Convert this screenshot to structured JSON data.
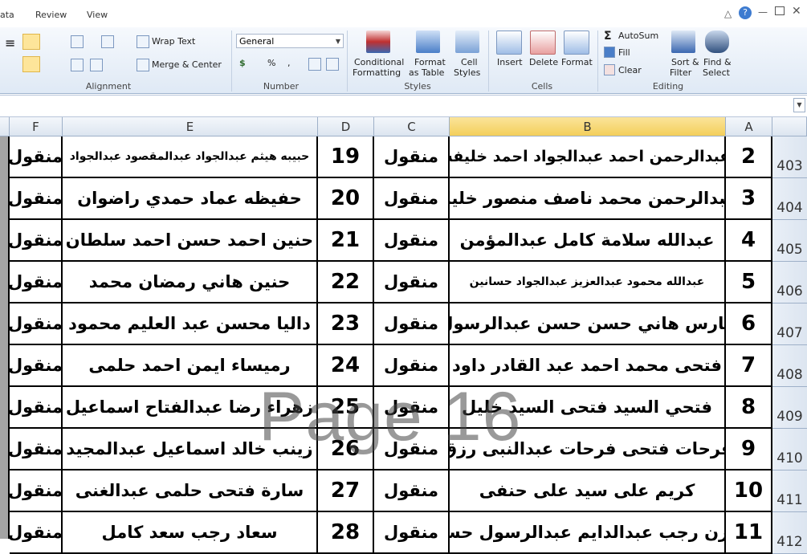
{
  "menu": {
    "items": [
      "ata",
      "Review",
      "View"
    ]
  },
  "ribbon": {
    "alignment": {
      "wrap_text": "Wrap Text",
      "merge_center": "Merge & Center",
      "label": "Alignment"
    },
    "number": {
      "format": "General",
      "currency": "$",
      "percent": "%",
      "comma": ",",
      "label": "Number"
    },
    "styles": {
      "conditional": "Conditional",
      "formatting": "Formatting",
      "format": "Format",
      "as_table": "as Table",
      "cell": "Cell",
      "cell_styles": "Styles",
      "label": "Styles"
    },
    "cells": {
      "insert": "Insert",
      "delete": "Delete",
      "format": "Format",
      "label": "Cells"
    },
    "editing": {
      "autosum": "AutoSum",
      "fill": "Fill",
      "clear": "Clear",
      "sort1": "Sort &",
      "sort2": "Filter",
      "find1": "Find &",
      "find2": "Select",
      "label": "Editing"
    }
  },
  "columns": [
    "F",
    "E",
    "D",
    "C",
    "B",
    "A"
  ],
  "rows": [
    {
      "row": "403",
      "A": "2",
      "B": "عبدالرحمن احمد عبدالجواد احمد خليفة",
      "C": "منقول",
      "D": "19",
      "E": "حبيبه هيثم عبدالجواد عبدالمقصود عبدالجواد",
      "F": "منقول"
    },
    {
      "row": "404",
      "A": "3",
      "B": "عبدالرحمن محمد ناصف منصور خليل",
      "C": "منقول",
      "D": "20",
      "E": "حفيظه عماد حمدي راضوان",
      "F": "منقول"
    },
    {
      "row": "405",
      "A": "4",
      "B": "عبدالله سلامة كامل عبدالمؤمن",
      "C": "منقول",
      "D": "21",
      "E": "حنين احمد حسن احمد سلطان",
      "F": "منقول"
    },
    {
      "row": "406",
      "A": "5",
      "B": "عبدالله محمود عبدالعزيز عبدالجواد حسانين",
      "C": "منقول",
      "D": "22",
      "E": "حنين هاني رمضان محمد",
      "F": "منقول"
    },
    {
      "row": "407",
      "A": "6",
      "B": "فارس هاني حسن حسن عبدالرسول",
      "C": "منقول",
      "D": "23",
      "E": "داليا محسن عبد العليم محمود",
      "F": "منقول"
    },
    {
      "row": "408",
      "A": "7",
      "B": "فتحى محمد احمد عبد القادر داود",
      "C": "منقول",
      "D": "24",
      "E": "رميساء ايمن احمد حلمى",
      "F": "منقول"
    },
    {
      "row": "409",
      "A": "8",
      "B": "فتحي السيد فتحى السيد خليل",
      "C": "منقول",
      "D": "25",
      "E": "زهراء رضا عبدالفتاح اسماعيل",
      "F": "منقول"
    },
    {
      "row": "410",
      "A": "9",
      "B": "فرحات فتحى فرحات عبدالنبى رزق",
      "C": "منقول",
      "D": "26",
      "E": "زينب خالد اسماعيل عبدالمجيد",
      "F": "منقول"
    },
    {
      "row": "411",
      "A": "10",
      "B": "كريم على سيد على حنفى",
      "C": "منقول",
      "D": "27",
      "E": "سارة فتحى حلمى عبدالغنى",
      "F": "منقول"
    },
    {
      "row": "412",
      "A": "11",
      "B": "مازن رجب عبدالدايم عبدالرسول حسن",
      "C": "منقول",
      "D": "28",
      "E": "سعاد رجب سعد كامل",
      "F": "منقول"
    }
  ],
  "watermark": "Page 16",
  "colors": {
    "accent": "#f3cf5b",
    "ribbon": "#dfe9f5"
  }
}
